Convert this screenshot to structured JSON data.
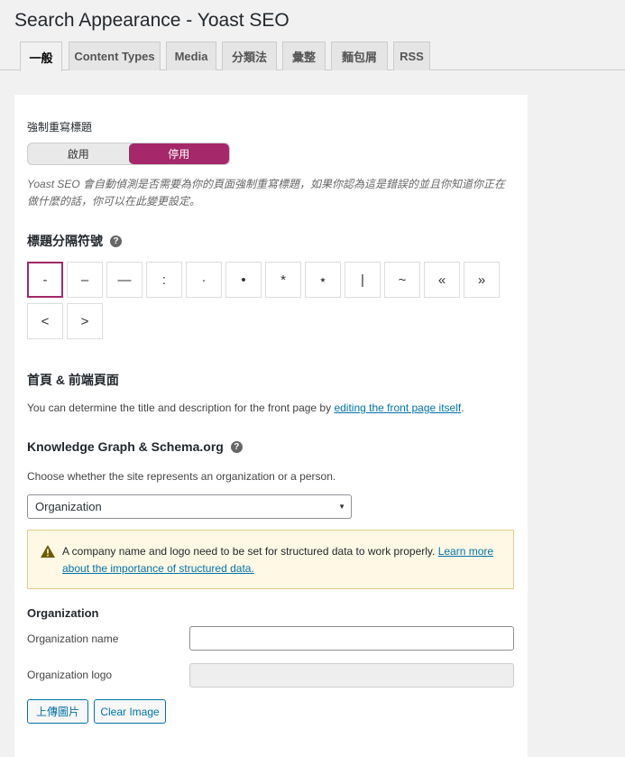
{
  "page": {
    "title": "Search Appearance - Yoast SEO"
  },
  "tabs": [
    {
      "label": "一般",
      "active": true
    },
    {
      "label": "Content Types"
    },
    {
      "label": "Media"
    },
    {
      "label": "分類法"
    },
    {
      "label": "彙整"
    },
    {
      "label": "麵包屑"
    },
    {
      "label": "RSS"
    }
  ],
  "force_rewrite": {
    "label": "強制重寫標題",
    "options": [
      "啟用",
      "停用"
    ],
    "selected": "停用",
    "help": "Yoast SEO 會自動偵測是否需要為你的頁面強制重寫標題，如果你認為這是錯誤的並且你知道你正在做什麼的話，你可以在此變更設定。"
  },
  "separator": {
    "heading": "標題分隔符號",
    "symbols": [
      "-",
      "–",
      "—",
      ":",
      "·",
      "•",
      "*",
      "⋆",
      "|",
      "~",
      "«",
      "»",
      "<",
      ">"
    ],
    "selected_index": 0
  },
  "frontpage": {
    "heading": "首頁 & 前端頁面",
    "text_before": "You can determine the title and description for the front page by ",
    "link_text": "editing the front page itself",
    "text_after": "."
  },
  "schema": {
    "heading": "Knowledge Graph & Schema.org",
    "description": "Choose whether the site represents an organization or a person.",
    "select_value": "Organization",
    "warning_text": "A company name and logo need to be set for structured data to work properly. ",
    "warning_link": "Learn more about the importance of structured data."
  },
  "organization": {
    "heading": "Organization",
    "name_label": "Organization name",
    "name_value": "",
    "logo_label": "Organization logo",
    "upload_button": "上傳圖片",
    "clear_button": "Clear Image"
  },
  "colors": {
    "accent": "#a4286a",
    "link": "#0073aa",
    "warning_bg": "#fff8e5"
  },
  "icons": {
    "help": "help-icon",
    "warning": "warning-icon",
    "select": "chevron-down-icon"
  }
}
